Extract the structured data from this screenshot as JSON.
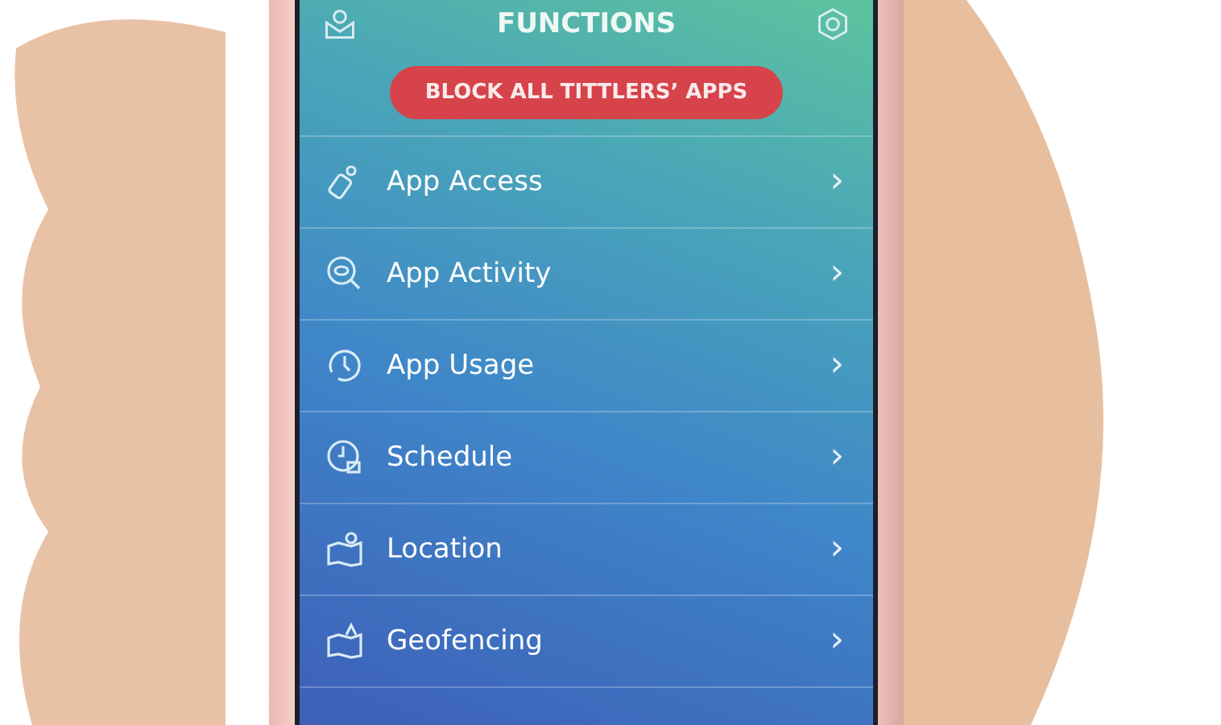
{
  "header": {
    "title": "FUNCTIONS"
  },
  "block_button": {
    "label": "BLOCK ALL TITTLERS’ APPS"
  },
  "menu": [
    {
      "label": "App Access",
      "chevron": "›"
    },
    {
      "label": "App Activity",
      "chevron": "›"
    },
    {
      "label": "App Usage",
      "chevron": "›"
    },
    {
      "label": "Schedule",
      "chevron": "›"
    },
    {
      "label": "Location",
      "chevron": "›"
    },
    {
      "label": "Geofencing",
      "chevron": "›"
    }
  ]
}
